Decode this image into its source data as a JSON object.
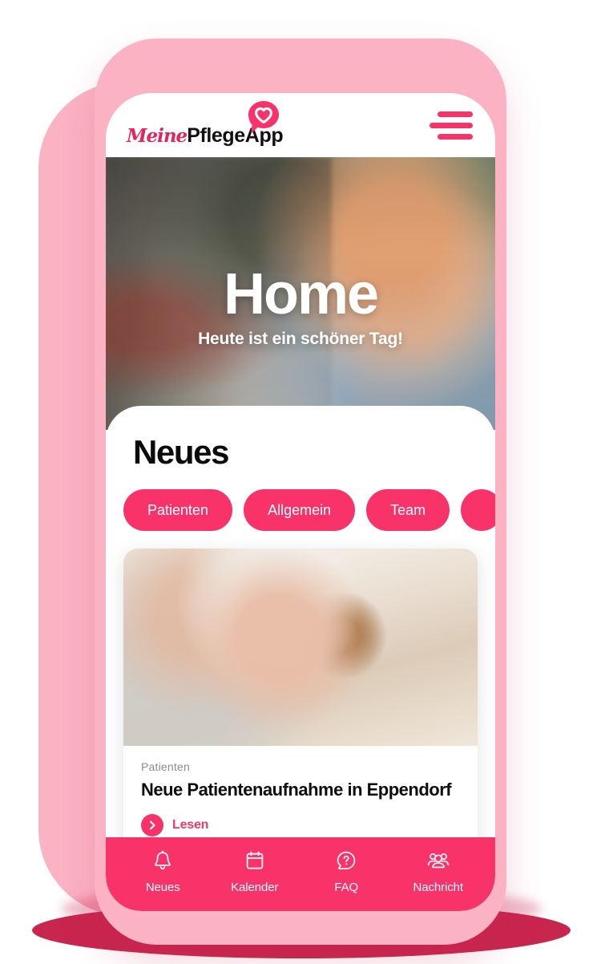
{
  "app": {
    "brand_script": "Meine",
    "brand_bold": "PflegeApp",
    "logo_icon": "heart-speech-bubble-icon",
    "menu_icon": "hamburger-menu-icon",
    "accent_color": "#f8336a",
    "frame_color": "#fbb3c4",
    "shadow_color": "#c9264f"
  },
  "hero": {
    "title": "Home",
    "subtitle": "Heute ist ein schöner Tag!",
    "photo_alt": "Laechelnde Pflegekraft im Denimhemd in einem Innenraum"
  },
  "news": {
    "heading": "Neues",
    "chips": [
      {
        "label": "Patienten",
        "active": true
      },
      {
        "label": "Allgemein",
        "active": false
      },
      {
        "label": "Team",
        "active": false
      },
      {
        "label": "",
        "active": false,
        "partial": true
      }
    ],
    "cards": [
      {
        "kicker": "Patienten",
        "title": "Neue Patientenaufnahme in Eppendorf",
        "cta_label": "Lesen",
        "cta_icon": "chevron-right-icon",
        "photo_alt": "Aeltere Frau mit weissem Haar wird gekaemmt"
      }
    ]
  },
  "bottom_nav": {
    "items": [
      {
        "label": "Neues",
        "icon": "bell-icon",
        "active": true
      },
      {
        "label": "Kalender",
        "icon": "calendar-icon",
        "active": false
      },
      {
        "label": "FAQ",
        "icon": "question-circle-icon",
        "active": false
      },
      {
        "label": "Nachricht",
        "icon": "people-group-icon",
        "active": false
      }
    ]
  }
}
